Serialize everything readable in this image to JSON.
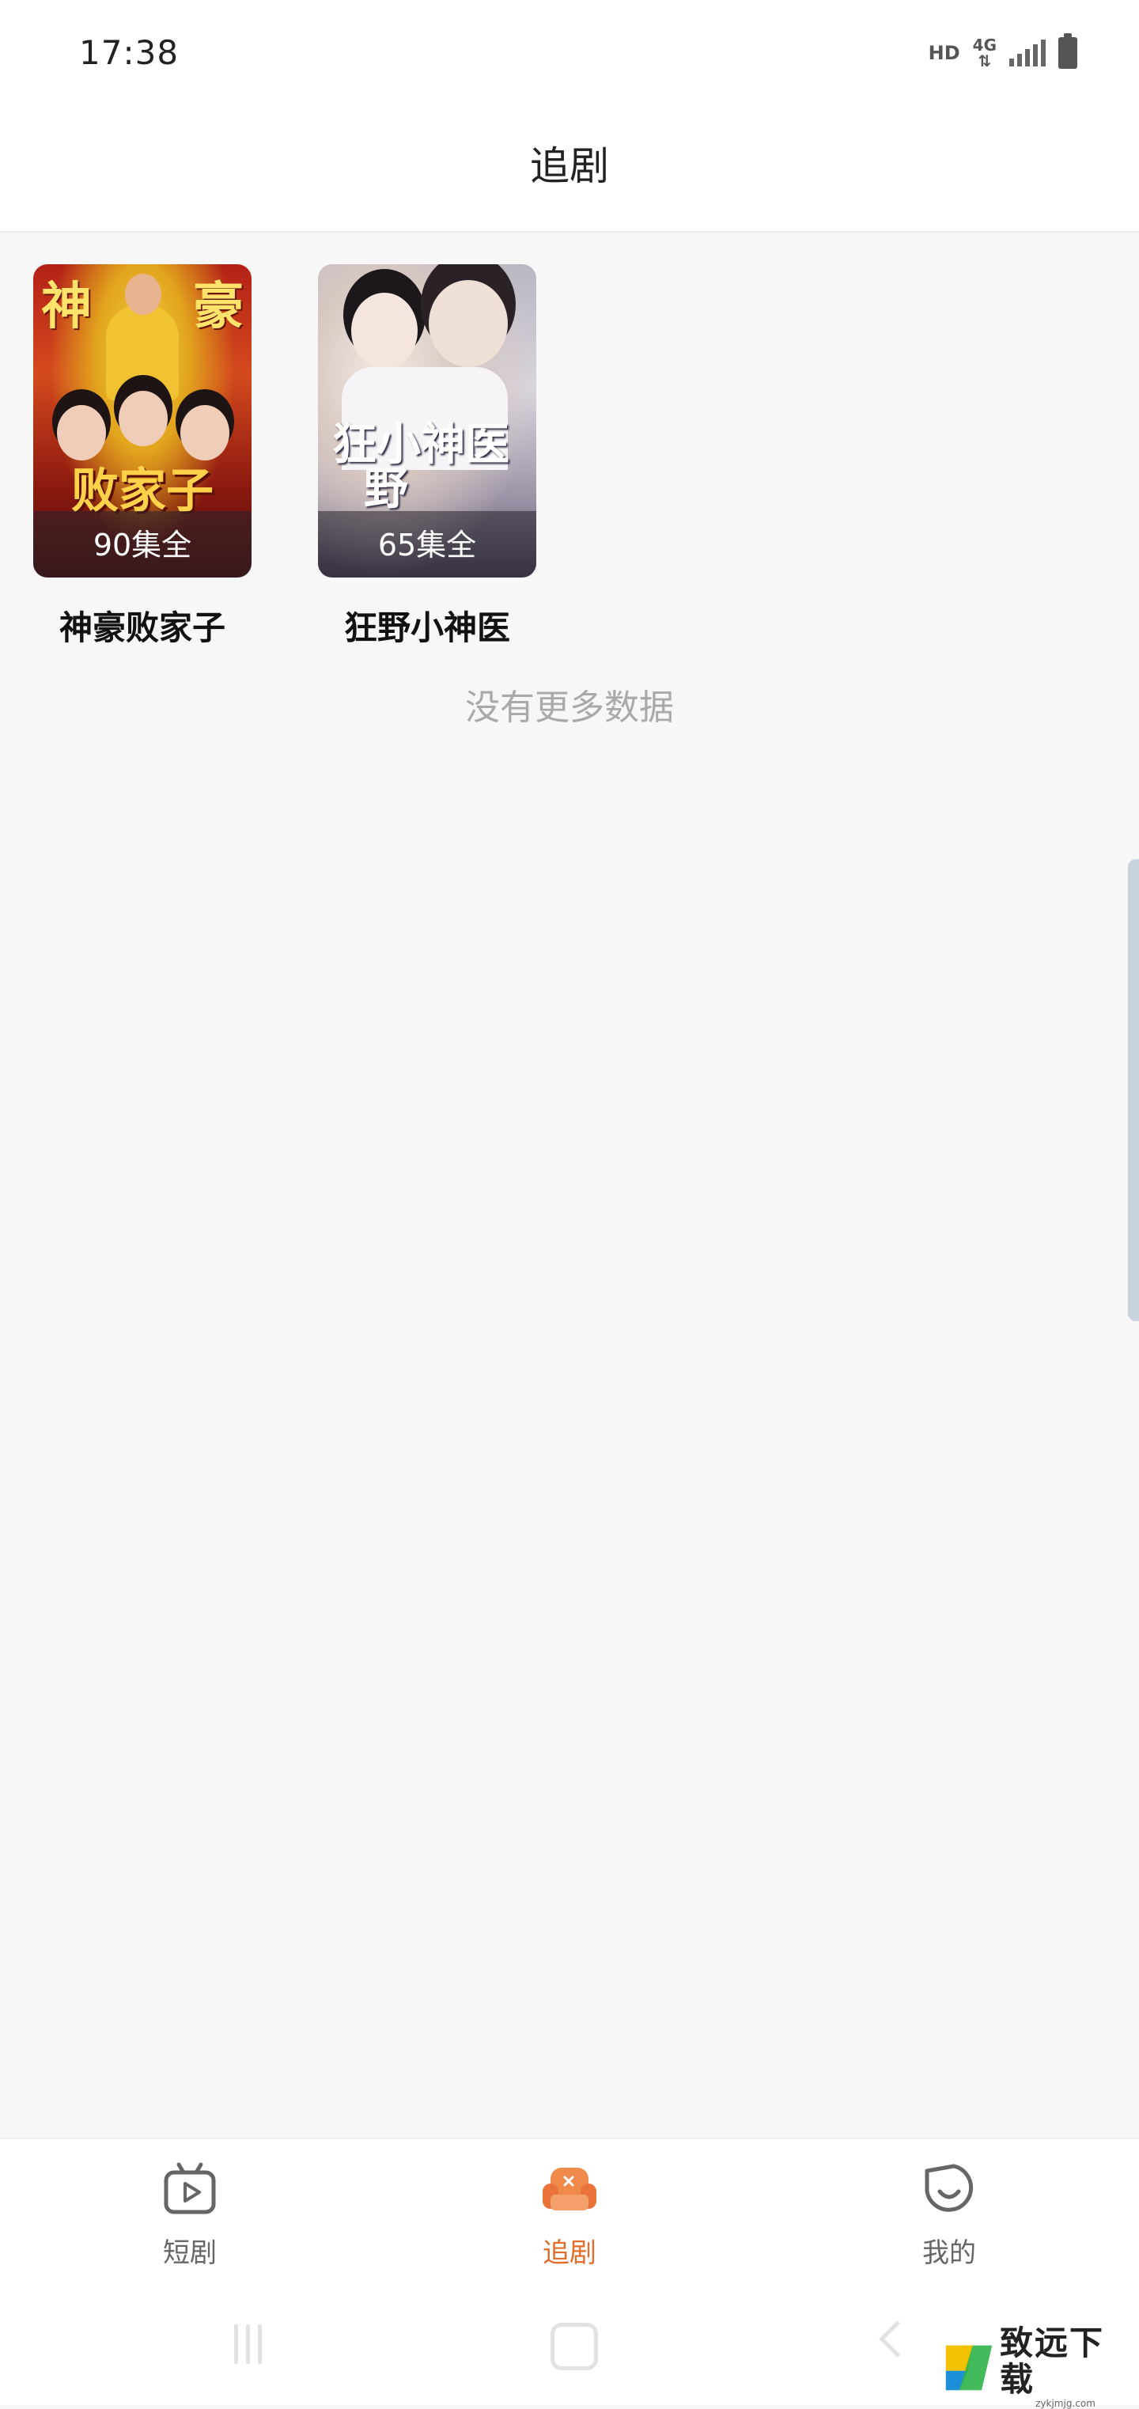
{
  "status_bar": {
    "time": "17:38",
    "hd": "HD",
    "network": "4G"
  },
  "header": {
    "title": "追剧"
  },
  "dramas": [
    {
      "title": "神豪败家子",
      "episodes": "90集全",
      "poster_text_top_left": "神",
      "poster_text_top_right": "豪",
      "poster_title": "败家子"
    },
    {
      "title": "狂野小神医",
      "episodes": "65集全",
      "poster_title_line1": "狂小神医",
      "poster_title_line2": "野"
    }
  ],
  "list_footer": "没有更多数据",
  "bottom_nav": {
    "items": [
      {
        "label": "短剧",
        "icon": "tv-play-icon",
        "active": false
      },
      {
        "label": "追剧",
        "icon": "sofa-icon",
        "active": true
      },
      {
        "label": "我的",
        "icon": "smile-face-icon",
        "active": false
      }
    ],
    "active_color": "#e26d2a",
    "inactive_color": "#666666"
  },
  "watermark": {
    "text": "致远下载",
    "sub": "zykjmjg.com"
  }
}
